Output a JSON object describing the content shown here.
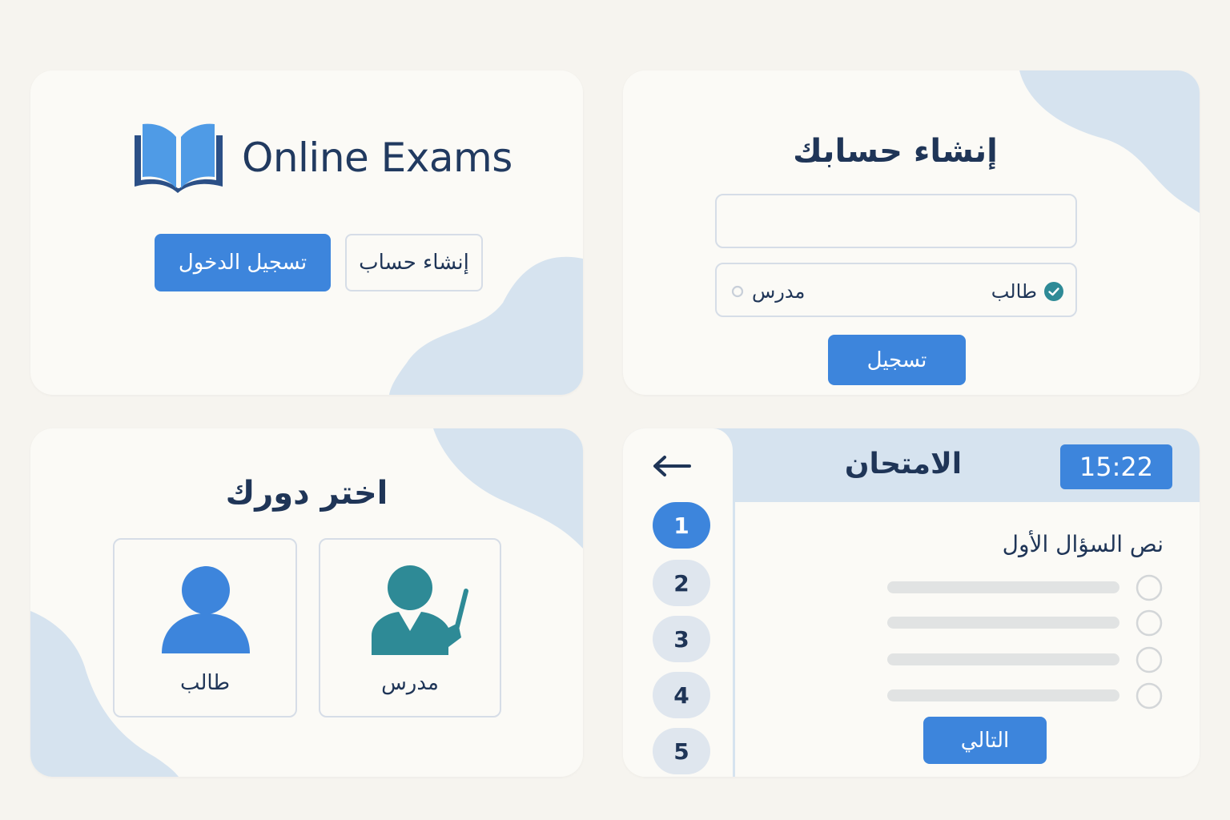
{
  "welcome": {
    "app_title": "Online Exams",
    "logo_icon": "open-book-icon",
    "login_label": "تسجيل الدخول",
    "signup_label": "إنشاء حساب"
  },
  "register": {
    "title": "إنشاء حسابك",
    "name_placeholder": "",
    "role_student": "طالب",
    "role_teacher": "مدرس",
    "selected_role": "طالب",
    "submit_label": "تسجيل"
  },
  "choose_role": {
    "title": "اختر دورك",
    "student_label": "طالب",
    "teacher_label": "مدرس",
    "student_icon": "person-icon",
    "teacher_icon": "teacher-pointer-icon"
  },
  "exam": {
    "title": "الامتحان",
    "timer": "15:22",
    "back_icon": "arrow-left-icon",
    "question_numbers": [
      "1",
      "2",
      "3",
      "4",
      "5"
    ],
    "active_question": "1",
    "question_text": "نص السؤال الأول",
    "options_count": 4,
    "next_label": "التالي"
  },
  "colors": {
    "primary": "#3d85dc",
    "dark_text": "#1f3557",
    "blob": "#d6e3ef",
    "teal": "#2e8a96",
    "card_bg": "#fbfaf6",
    "page_bg": "#f6f4ef"
  }
}
